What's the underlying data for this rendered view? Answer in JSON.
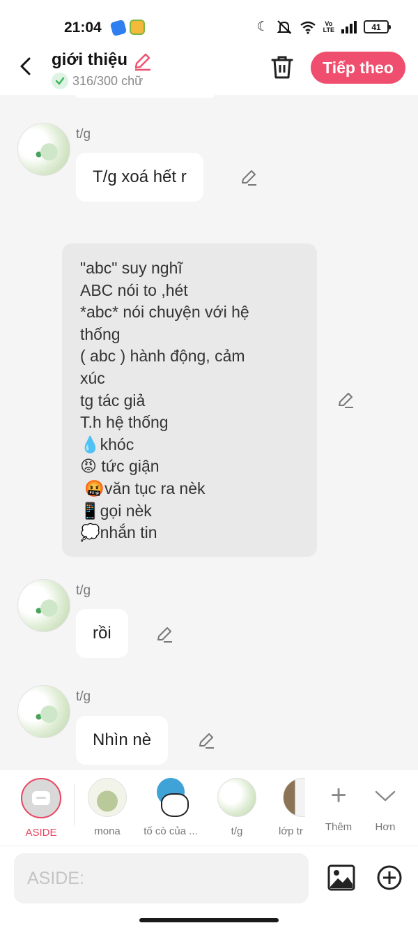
{
  "status_bar": {
    "time": "21:04",
    "battery": "41",
    "icons": [
      "moon-icon",
      "mute-bell-icon",
      "wifi-icon",
      "volte-icon",
      "signal-icon",
      "battery-icon"
    ]
  },
  "header": {
    "title": "giới thiệu",
    "word_count": "316/300 chữ",
    "next_label": "Tiếp theo",
    "accent_color": "#f04e6e"
  },
  "messages": [
    {
      "sender": "t/g",
      "text": "T/g xoá hết r"
    },
    {
      "aside_lines": [
        "\"abc\" suy nghĩ",
        "ABC nói to ,hét",
        "*abc* nói chuyện với hệ",
        "thống",
        "( abc ) hành động, cảm",
        "xúc",
        "tg tác giả",
        "T.h hệ thống",
        "💧khóc",
        "😡 tức giận",
        " 🤬văn tục ra nèk",
        "📱gọi nèk",
        "💭nhắn tin"
      ]
    },
    {
      "sender": "t/g",
      "text": "rồi"
    },
    {
      "sender": "t/g",
      "text": "Nhìn nè"
    }
  ],
  "characters": [
    {
      "name": "ASIDE",
      "selected": true
    },
    {
      "name": "mona"
    },
    {
      "name": "tố cò của ..."
    },
    {
      "name": "t/g"
    },
    {
      "name": "lớp tr"
    }
  ],
  "actions": {
    "more_label": "Thêm",
    "collapse_label": "Hơn"
  },
  "input": {
    "placeholder": "ASIDE:"
  }
}
